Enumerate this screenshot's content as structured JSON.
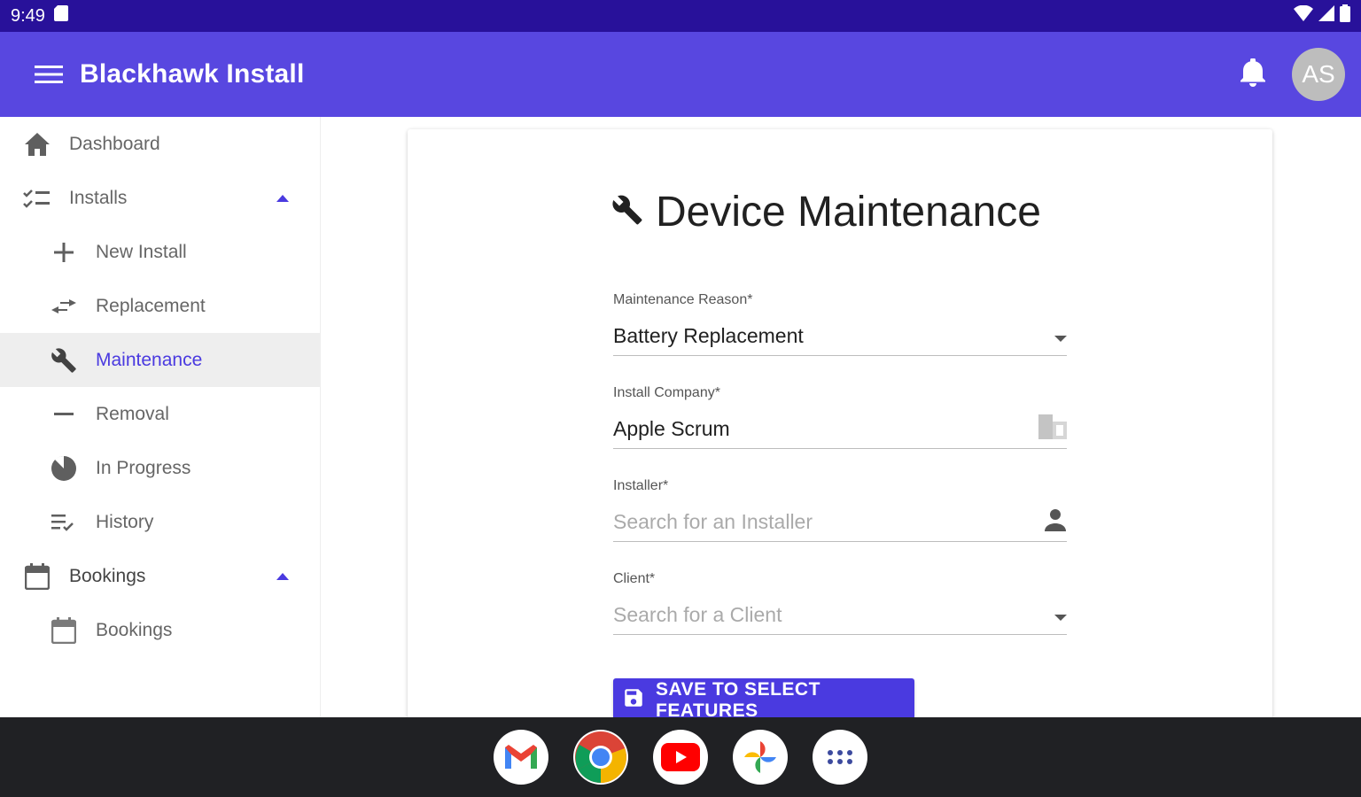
{
  "status_bar": {
    "time": "9:49"
  },
  "app_bar": {
    "title": "Blackhawk Install",
    "avatar_initials": "AS"
  },
  "sidebar": {
    "items": [
      {
        "label": "Dashboard",
        "icon": "home-icon"
      },
      {
        "label": "Installs",
        "icon": "checklist-icon"
      },
      {
        "label": "New Install",
        "icon": "plus-icon"
      },
      {
        "label": "Replacement",
        "icon": "swap-icon"
      },
      {
        "label": "Maintenance",
        "icon": "wrench-icon"
      },
      {
        "label": "Removal",
        "icon": "minus-icon"
      },
      {
        "label": "In Progress",
        "icon": "pie-icon"
      },
      {
        "label": "History",
        "icon": "list-check-icon"
      },
      {
        "label": "Bookings",
        "icon": "calendar-icon"
      },
      {
        "label": "Bookings",
        "icon": "calendar-icon"
      }
    ]
  },
  "form": {
    "title": "Device Maintenance",
    "fields": {
      "maintenance_reason": {
        "label": "Maintenance Reason*",
        "value": "Battery Replacement"
      },
      "install_company": {
        "label": "Install Company*",
        "value": "Apple Scrum"
      },
      "installer": {
        "label": "Installer*",
        "placeholder": "Search for an Installer"
      },
      "client": {
        "label": "Client*",
        "placeholder": "Search for a Client"
      }
    },
    "save_label": "SAVE TO SELECT FEATURES"
  },
  "colors": {
    "status_bar": "#28119a",
    "app_bar": "#5847e0",
    "accent": "#4a3ae0"
  },
  "dock": [
    "gmail-icon",
    "chrome-icon",
    "youtube-icon",
    "photos-icon",
    "apps-icon"
  ]
}
